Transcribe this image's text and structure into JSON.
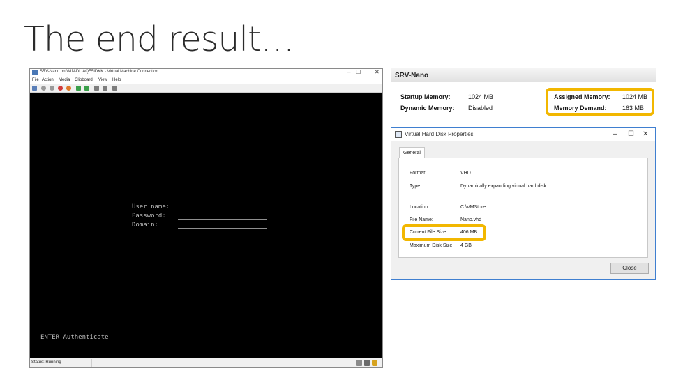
{
  "slide": {
    "title": "The end result…"
  },
  "vm_window": {
    "title": "SRV-Nano on WIN-DLIAQE5IDKK - Virtual Machine Connection",
    "minimize": "–",
    "maximize": "☐",
    "close": "✕",
    "menu": [
      "File",
      "Action",
      "Media",
      "Clipboard",
      "View",
      "Help"
    ],
    "login": {
      "username_label": "User name:",
      "password_label": "Password:",
      "domain_label": "Domain:"
    },
    "footer_hint": "ENTER Authenticate",
    "status": "Status: Running"
  },
  "memory_panel": {
    "title": "SRV-Nano",
    "startup_memory_label": "Startup Memory:",
    "startup_memory_value": "1024 MB",
    "dynamic_memory_label": "Dynamic Memory:",
    "dynamic_memory_value": "Disabled",
    "assigned_memory_label": "Assigned Memory:",
    "assigned_memory_value": "1024 MB",
    "memory_demand_label": "Memory Demand:",
    "memory_demand_value": "163 MB"
  },
  "vhd_dialog": {
    "title": "Virtual Hard Disk Properties",
    "tab": "General",
    "format_label": "Format:",
    "format_value": "VHD",
    "type_label": "Type:",
    "type_value": "Dynamically expanding virtual hard disk",
    "location_label": "Location:",
    "location_value": "C:\\VMStore",
    "file_name_label": "File Name:",
    "file_name_value": "Nano.vhd",
    "current_size_label": "Current File Size:",
    "current_size_value": "406 MB",
    "max_size_label": "Maximum Disk Size:",
    "max_size_value": "4 GB",
    "close_button": "Close",
    "minimize": "–",
    "maximize": "☐",
    "close": "✕"
  },
  "colors": {
    "highlight": "#f2b700",
    "vm_screen": "#000000"
  }
}
